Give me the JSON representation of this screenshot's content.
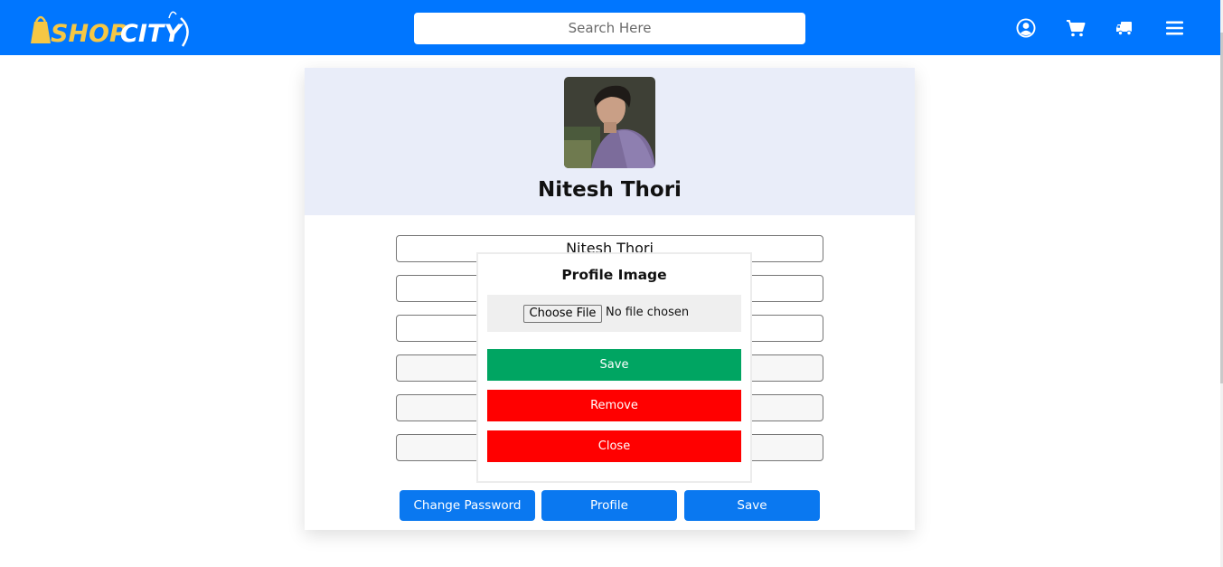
{
  "brand": {
    "name": "SHOPCITY",
    "colors": {
      "bag": "#f6c744",
      "text_yellow": "#f6c744",
      "text_white": "#ffffff"
    }
  },
  "header": {
    "search_placeholder": "Search Here",
    "icons": [
      "user-circle-icon",
      "cart-icon",
      "truck-icon",
      "menu-icon"
    ],
    "background": "#0076ff"
  },
  "profile": {
    "name": "Nitesh Thori",
    "fields": [
      {
        "value": "Nitesh Thori",
        "disabled": false
      },
      {
        "value": "",
        "disabled": false
      },
      {
        "value": "",
        "disabled": false
      },
      {
        "value": "",
        "disabled": true
      },
      {
        "value": "",
        "disabled": true
      },
      {
        "value": "",
        "disabled": true
      }
    ],
    "buttons": {
      "change_password": "Change Password",
      "profile": "Profile",
      "save": "Save"
    }
  },
  "modal": {
    "title": "Profile Image",
    "choose_file": "Choose File",
    "file_status": "No file chosen",
    "save": "Save",
    "remove": "Remove",
    "close": "Close",
    "colors": {
      "save": "#00a562",
      "remove": "#ff0000",
      "close": "#ff0000"
    }
  }
}
